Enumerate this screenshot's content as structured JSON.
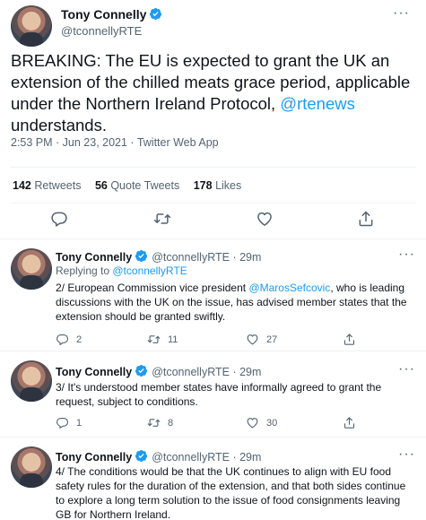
{
  "main_tweet": {
    "author_name": "Tony Connelly",
    "author_handle": "@tconnellyRTE",
    "text_before_link": "BREAKING: The EU is expected to grant the UK an extension of the chilled meats grace period, applicable under the Northern Ireland Protocol, ",
    "link_text": "@rtenews",
    "text_after_link": " understands.",
    "timestamp": "2:53 PM · Jun 23, 2021 · Twitter Web App",
    "retweets_count": "142",
    "retweets_label": "Retweets",
    "quotes_count": "56",
    "quotes_label": "Quote Tweets",
    "likes_count": "178",
    "likes_label": "Likes"
  },
  "replies": [
    {
      "author_name": "Tony Connelly",
      "author_handle": "@tconnellyRTE · 29m",
      "replying_prefix": "Replying to ",
      "replying_to": "@tconnellyRTE",
      "text_before_link": "2/ European Commission vice president ",
      "link_text": "@MarosSefcovic",
      "text_after_link": ", who is leading discussions with the UK on the issue, has advised member states that the extension should be granted swiftly.",
      "reply_count": "2",
      "retweet_count": "11",
      "like_count": "27"
    },
    {
      "author_name": "Tony Connelly",
      "author_handle": "@tconnellyRTE · 29m",
      "text": "3/ It's understood member states have informally agreed to grant the request, subject to conditions.",
      "reply_count": "1",
      "retweet_count": "8",
      "like_count": "30"
    },
    {
      "author_name": "Tony Connelly",
      "author_handle": "@tconnellyRTE · 29m",
      "text": "4/ The conditions would be that the UK continues to align with EU food safety rules for the duration of the extension, and that both sides continue to explore a long term solution to the issue of food consignments leaving GB for Northern Ireland."
    }
  ],
  "icons": {
    "reply": "reply-icon",
    "retweet": "retweet-icon",
    "like": "heart-icon",
    "share": "share-icon",
    "verified": "verified-badge-icon",
    "more": "more-icon"
  },
  "colors": {
    "accent": "#1d9bf0",
    "text": "#0f1419",
    "muted": "#536471",
    "divider": "#eff3f4"
  }
}
